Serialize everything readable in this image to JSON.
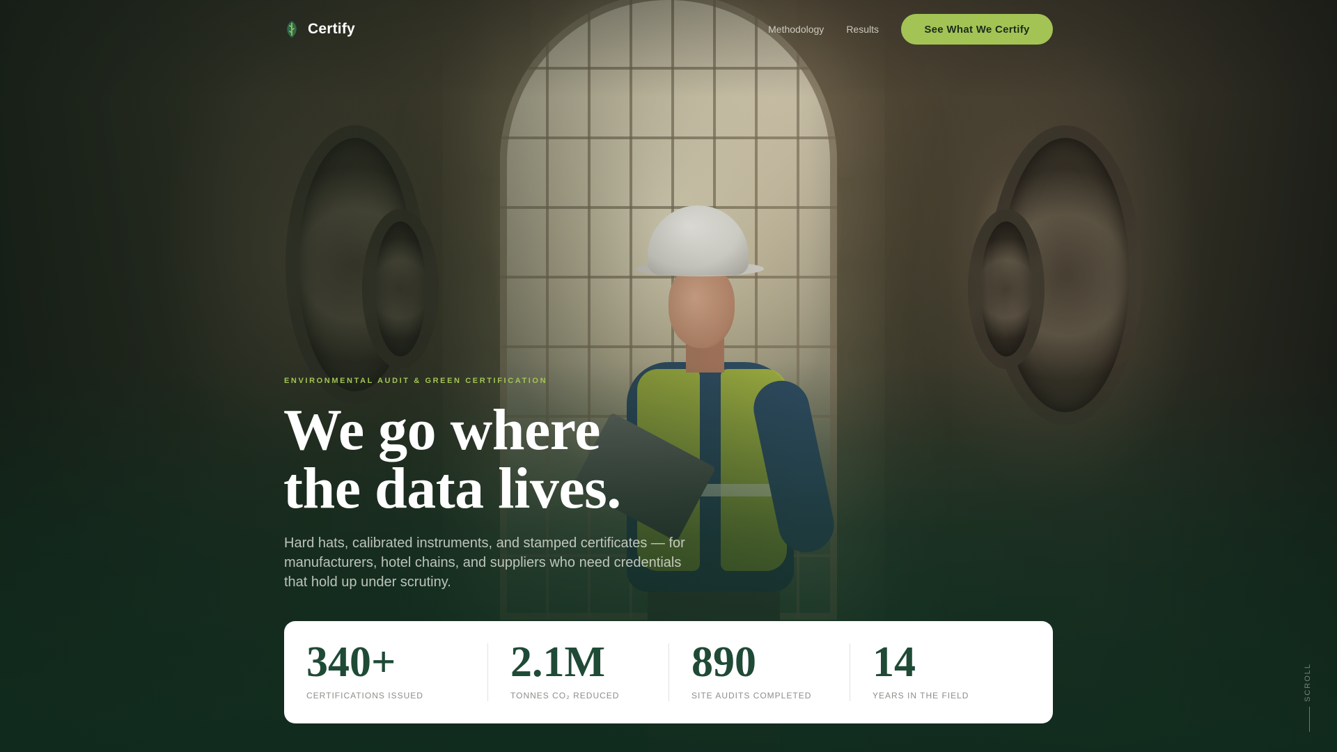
{
  "nav": {
    "brand": "Certify",
    "links": [
      "Methodology",
      "Results"
    ],
    "cta": "See What We Certify"
  },
  "hero": {
    "eyebrow": "ENVIRONMENTAL AUDIT & GREEN CERTIFICATION",
    "headline_line1": "We go where",
    "headline_line2": "the data lives.",
    "subcopy": "Hard hats, calibrated instruments, and stamped certificates — for manufacturers, hotel chains, and suppliers who need credentials that hold up under scrutiny."
  },
  "stats": [
    {
      "value": "340+",
      "label": "CERTIFICATIONS ISSUED"
    },
    {
      "value": "2.1M",
      "label": "TONNES CO₂ REDUCED"
    },
    {
      "value": "890",
      "label": "SITE AUDITS COMPLETED"
    },
    {
      "value": "14",
      "label": "YEARS IN THE FIELD"
    }
  ],
  "scroll_label": "SCROLL",
  "colors": {
    "accent": "#a3c455",
    "stat_value": "#1f4a36",
    "card_bg": "#ffffff"
  },
  "icons": {
    "brand": "leaf-shield-icon"
  }
}
